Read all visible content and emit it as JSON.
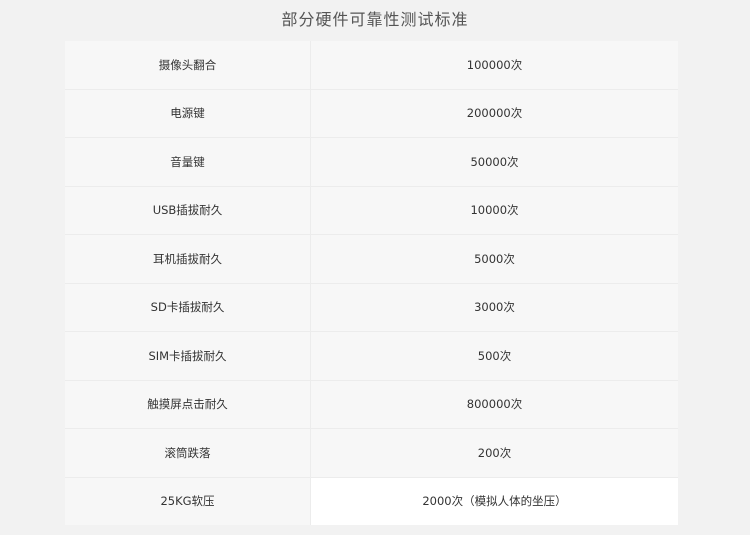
{
  "title": "部分硬件可靠性测试标准",
  "rows": [
    {
      "name": "摄像头翻合",
      "value": "100000次"
    },
    {
      "name": "电源键",
      "value": "200000次"
    },
    {
      "name": "音量键",
      "value": "50000次"
    },
    {
      "name": "USB插拔耐久",
      "value": "10000次"
    },
    {
      "name": "耳机插拔耐久",
      "value": "5000次"
    },
    {
      "name": "SD卡插拔耐久",
      "value": "3000次"
    },
    {
      "name": "SIM卡插拔耐久",
      "value": "500次"
    },
    {
      "name": "触摸屏点击耐久",
      "value": "800000次"
    },
    {
      "name": "滚筒跌落",
      "value": "200次"
    },
    {
      "name": "25KG软压",
      "value": "2000次（模拟人体的坐压）"
    }
  ]
}
